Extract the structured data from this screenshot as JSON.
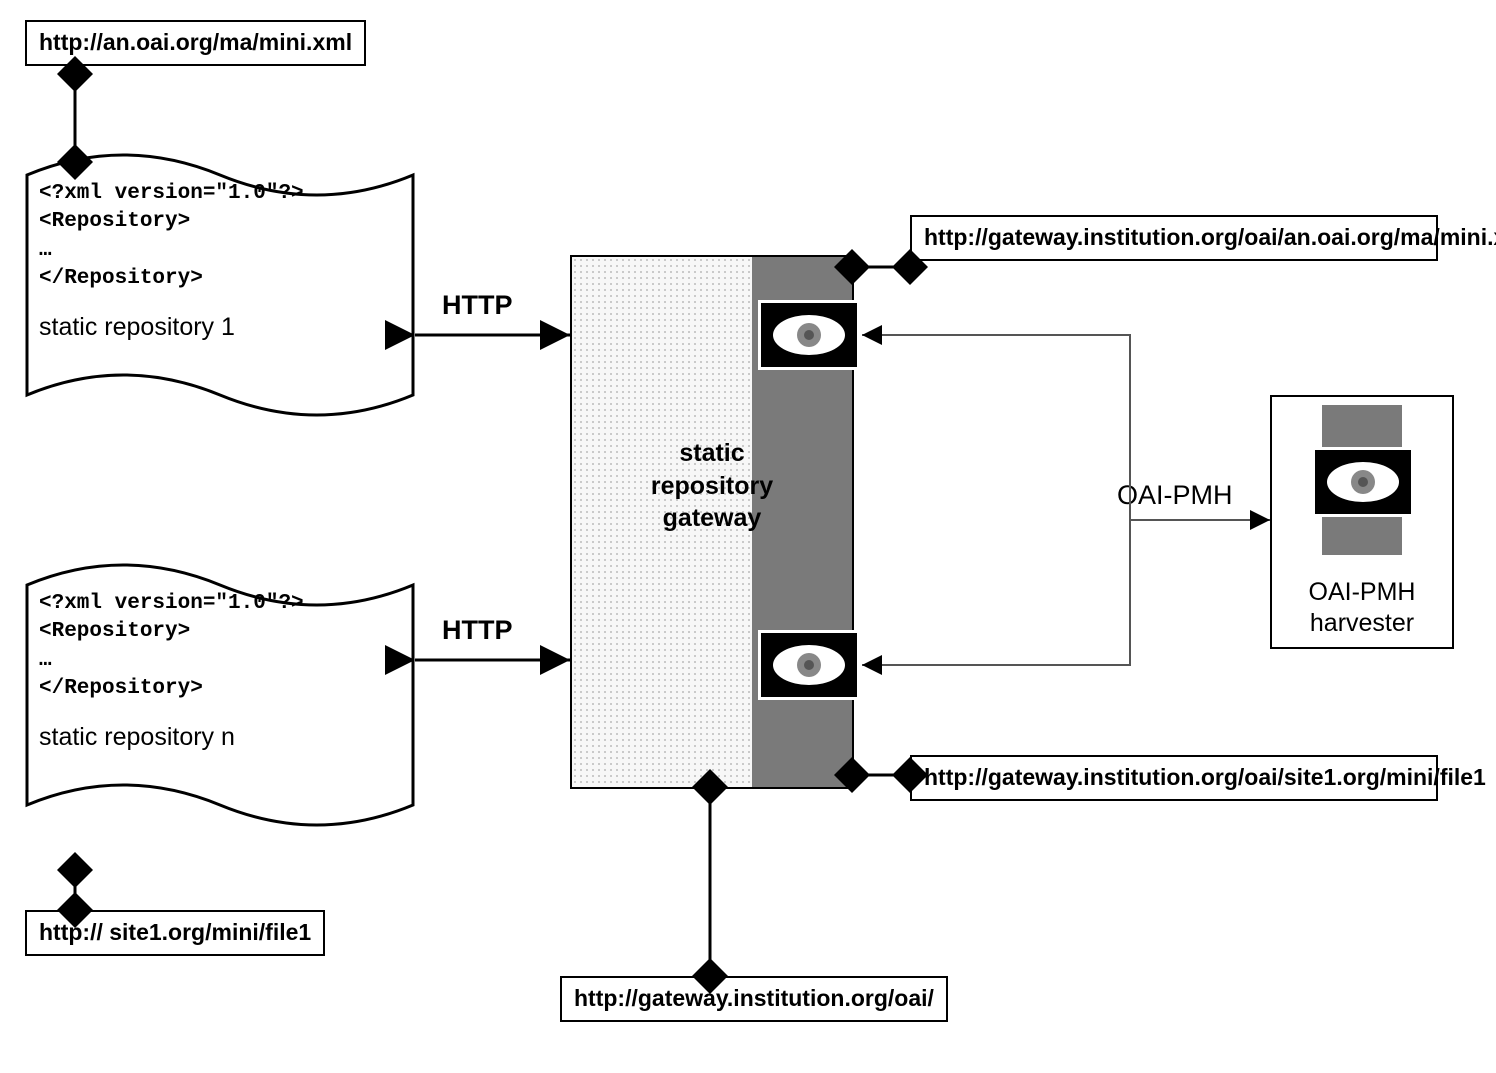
{
  "urls": {
    "top_left": "http://an.oai.org/ma/mini.xml",
    "bottom_left": "http:// site1.org/mini/file1",
    "gateway_top": "http://gateway.institution.org/oai/an.oai.org/ma/mini.xml",
    "gateway_bottom_right": "http://gateway.institution.org/oai/site1.org/mini/file1",
    "gateway_base": "http://gateway.institution.org/oai/"
  },
  "docs": {
    "repo1": {
      "l1": "<?xml version=\"1.0\"?>",
      "l2": "<Repository>",
      "l3": " …",
      "l4": "</Repository>",
      "caption": "static repository 1"
    },
    "repoN": {
      "l1": "<?xml version=\"1.0\"?>",
      "l2": "<Repository>",
      "l3": " …",
      "l4": "</Repository>",
      "caption": "static repository n"
    }
  },
  "labels": {
    "http1": "HTTP",
    "http2": "HTTP",
    "oaipmh": "OAI-PMH",
    "gateway": "static\nrepository\ngateway",
    "gateway_l1": "static",
    "gateway_l2": "repository",
    "gateway_l3": "gateway",
    "harvester_l1": "OAI-PMH",
    "harvester_l2": "harvester"
  }
}
